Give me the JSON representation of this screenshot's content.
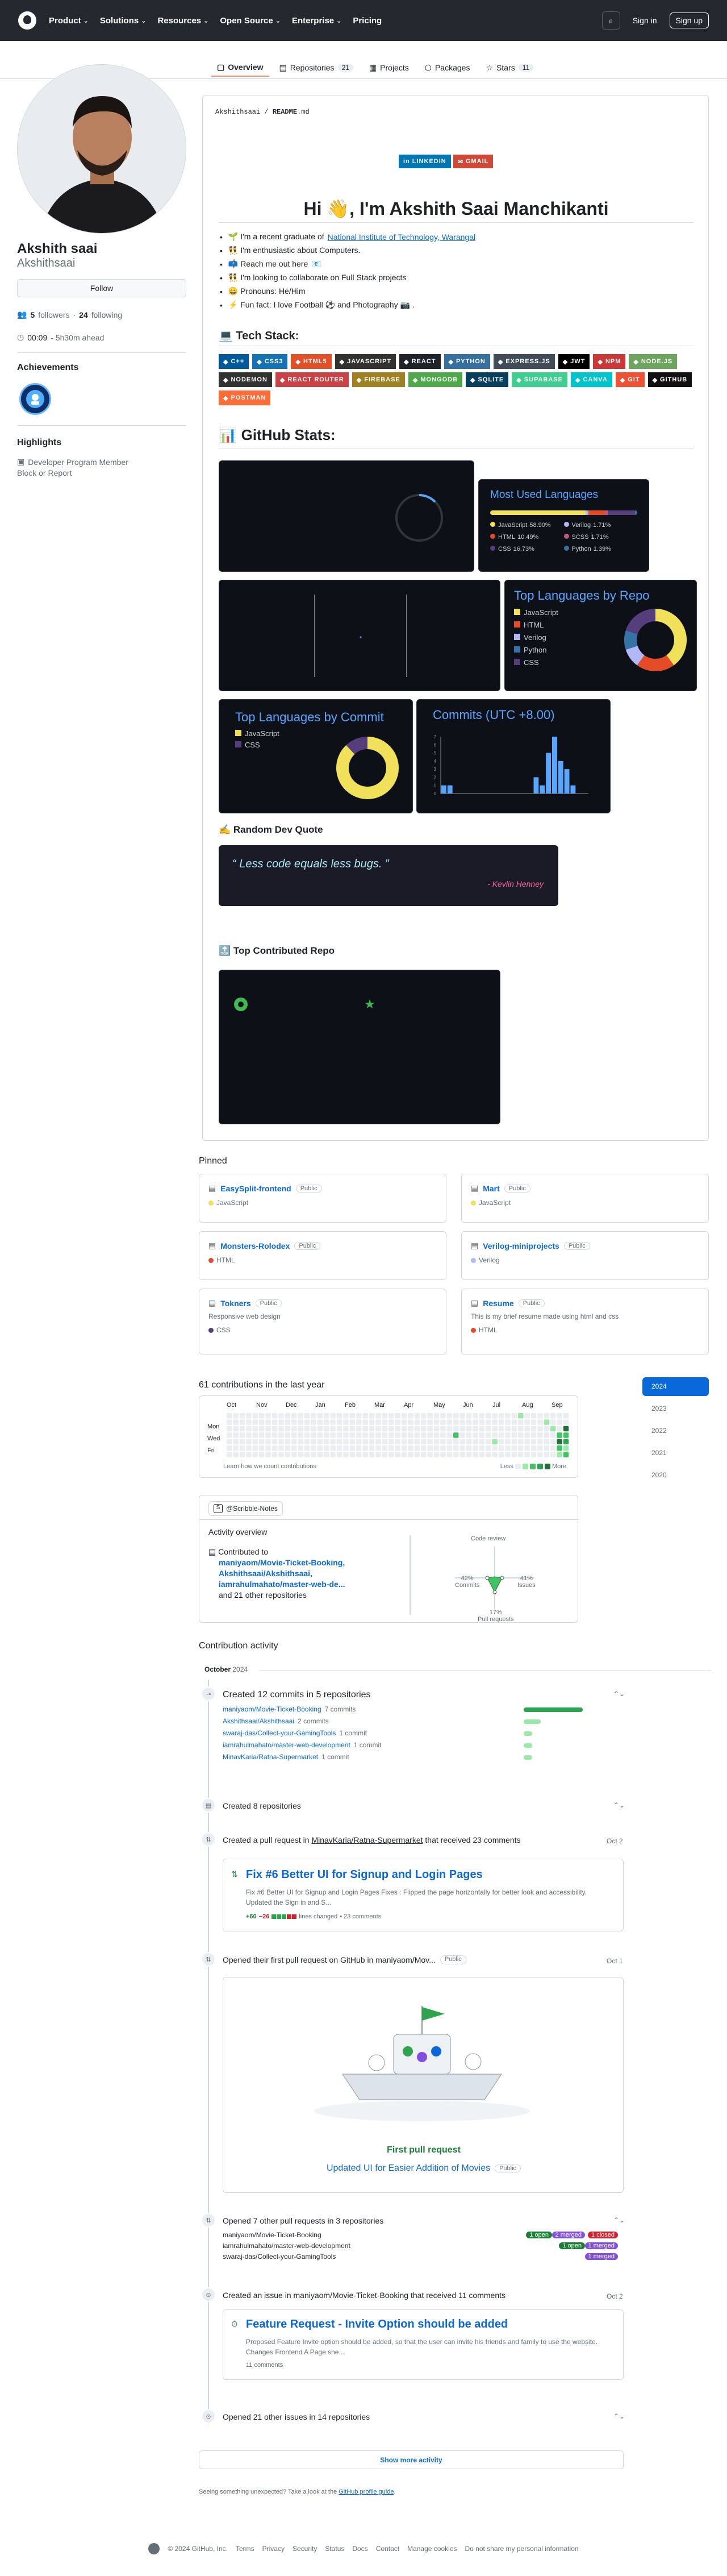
{
  "nav": {
    "items": [
      "Product",
      "Solutions",
      "Resources",
      "Open Source",
      "Enterprise",
      "Pricing"
    ],
    "sign_in": "Sign in",
    "sign_up": "Sign up"
  },
  "tabs": [
    {
      "label": "Overview",
      "count": ""
    },
    {
      "label": "Repositories",
      "count": "21"
    },
    {
      "label": "Projects",
      "count": ""
    },
    {
      "label": "Packages",
      "count": ""
    },
    {
      "label": "Stars",
      "count": "11"
    }
  ],
  "profile": {
    "full_name": "Akshith saai",
    "username": "Akshithsaai",
    "follow_label": "Follow",
    "followers_count": "5",
    "followers_label": "followers",
    "following_count": "24",
    "following_label": "following",
    "local_time": "00:09",
    "tz_offset": "- 5h30m ahead",
    "achievements_h": "Achievements",
    "highlights_h": "Highlights",
    "highlight_item": "Developer Program Member",
    "block_report": "Block or Report"
  },
  "readme": {
    "path_user": "Akshithsaai",
    "path_sep": " / ",
    "path_file": "README",
    "path_ext": ".md",
    "badges": [
      "LINKEDIN",
      "GMAIL"
    ],
    "title": "Hi 👋, I'm Akshith Saai Manchikanti",
    "bullets": [
      {
        "pre": "🌱 I'm a recent graduate of ",
        "link": "National Institute of Technology, Warangal",
        "post": ""
      },
      {
        "pre": "👯 I'm enthusiastic about Computers.",
        "link": "",
        "post": ""
      },
      {
        "pre": "📫 Reach me out here ",
        "link": "📧",
        "post": ""
      },
      {
        "pre": "👯 I'm looking to collaborate on Full Stack projects",
        "link": "",
        "post": ""
      },
      {
        "pre": "😄 Pronouns: He/Him",
        "link": "",
        "post": ""
      },
      {
        "pre": "⚡ Fun fact: I love Football ⚽ and Photography 📷 .",
        "link": "",
        "post": ""
      }
    ],
    "tech_stack_h": "💻 Tech Stack:",
    "tech": [
      {
        "label": "C++",
        "color": "#00599c"
      },
      {
        "label": "CSS3",
        "color": "#1572b6"
      },
      {
        "label": "HTML5",
        "color": "#e34f26"
      },
      {
        "label": "JAVASCRIPT",
        "color": "#323330"
      },
      {
        "label": "REACT",
        "color": "#20232a"
      },
      {
        "label": "PYTHON",
        "color": "#3670a0"
      },
      {
        "label": "EXPRESS.JS",
        "color": "#404d59"
      },
      {
        "label": "JWT",
        "color": "#000000"
      },
      {
        "label": "NPM",
        "color": "#cb3837"
      },
      {
        "label": "NODE.JS",
        "color": "#6da55f"
      },
      {
        "label": "NODEMON",
        "color": "#323330"
      },
      {
        "label": "REACT ROUTER",
        "color": "#ca4245"
      },
      {
        "label": "FIREBASE",
        "color": "#a08021"
      },
      {
        "label": "MONGODB",
        "color": "#4ea94b"
      },
      {
        "label": "SQLITE",
        "color": "#07405e"
      },
      {
        "label": "SUPABASE",
        "color": "#3ecf8e"
      },
      {
        "label": "CANVA",
        "color": "#00c4cc"
      },
      {
        "label": "GIT",
        "color": "#f05033"
      },
      {
        "label": "GITHUB",
        "color": "#121011"
      },
      {
        "label": "POSTMAN",
        "color": "#ff6c37"
      }
    ],
    "stats_h": "📊 GitHub Stats:",
    "most_used_h": "Most Used Languages",
    "most_used": [
      {
        "name": "JavaScript",
        "pct": "58.90%",
        "value": 58.9,
        "color": "#f1e05a"
      },
      {
        "name": "Verilog",
        "pct": "1.71%",
        "value": 1.71,
        "color": "#b2b7f8"
      },
      {
        "name": "HTML",
        "pct": "10.49%",
        "value": 10.49,
        "color": "#e34c26"
      },
      {
        "name": "SCSS",
        "pct": "1.71%",
        "value": 1.71,
        "color": "#c6538c"
      },
      {
        "name": "CSS",
        "pct": "16.73%",
        "value": 16.73,
        "color": "#563d7c"
      },
      {
        "name": "Python",
        "pct": "1.39%",
        "value": 1.39,
        "color": "#3572a5"
      }
    ],
    "top_repo_h": "Top Languages by Repo",
    "top_repo": [
      {
        "name": "JavaScript",
        "color": "#f1e05a",
        "value": 40
      },
      {
        "name": "HTML",
        "color": "#e34c26",
        "value": 20
      },
      {
        "name": "Verilog",
        "color": "#b2b7f8",
        "value": 10
      },
      {
        "name": "Python",
        "color": "#3572a5",
        "value": 10
      },
      {
        "name": "CSS",
        "color": "#563d7c",
        "value": 20
      }
    ],
    "top_commit_h": "Top Languages by Commit",
    "top_commit": [
      {
        "name": "JavaScript",
        "color": "#f1e05a",
        "value": 88
      },
      {
        "name": "CSS",
        "color": "#563d7c",
        "value": 12
      }
    ],
    "commits_h": "Commits (UTC +8.00)",
    "commits_y_ticks": [
      "7",
      "6",
      "5",
      "4",
      "3",
      "2",
      "1",
      "0"
    ],
    "commits_bars": [
      1,
      1,
      0,
      0,
      0,
      0,
      0,
      0,
      0,
      0,
      0,
      0,
      0,
      0,
      0,
      2,
      1,
      5,
      7,
      4,
      3,
      1,
      0,
      0
    ],
    "quote_h": "✍️ Random Dev Quote",
    "quote_text": "“ Less code equals less bugs. ”",
    "quote_author": "- Kevlin Henney",
    "top_repo_section_h": "🔝 Top Contributed Repo"
  },
  "pinned": {
    "heading": "Pinned",
    "public": "Public",
    "items": [
      {
        "name": "EasySplit-frontend",
        "desc": "",
        "lang": "JavaScript",
        "color": "#f1e05a"
      },
      {
        "name": "Mart",
        "desc": "",
        "lang": "JavaScript",
        "color": "#f1e05a"
      },
      {
        "name": "Monsters-Rolodex",
        "desc": "",
        "lang": "HTML",
        "color": "#e34c26"
      },
      {
        "name": "Verilog-miniprojects",
        "desc": "",
        "lang": "Verilog",
        "color": "#b2b7f8"
      },
      {
        "name": "Tokners",
        "desc": "Responsive web design",
        "lang": "CSS",
        "color": "#563d7c"
      },
      {
        "name": "Resume",
        "desc": "This is my brief resume made using html and css",
        "lang": "HTML",
        "color": "#e34c26"
      }
    ]
  },
  "contributions": {
    "heading": "61 contributions in the last year",
    "months": [
      "Oct",
      "Nov",
      "Dec",
      "Jan",
      "Feb",
      "Mar",
      "Apr",
      "May",
      "Jun",
      "Jul",
      "Aug",
      "Sep"
    ],
    "days": [
      "Mon",
      "Wed",
      "Fri"
    ],
    "learn": "Learn how we count contributions",
    "less": "Less",
    "more": "More",
    "years": [
      "2024",
      "2023",
      "2022",
      "2021",
      "2020"
    ],
    "org": "@Scribble-Notes",
    "activity_overview": "Activity overview",
    "contributed_to": "Contributed to",
    "repos": "maniyaom/Movie-Ticket-Booking, Akshithsaai/Akshithsaai, iamrahulmahato/master-web-de...",
    "and_more": "and 21 other repositories",
    "code_review": "Code review",
    "commits_pct": "42%",
    "commits_label": "Commits",
    "issues_pct": "41%",
    "issues_label": "Issues",
    "pr_pct": "17%",
    "pr_label": "Pull requests"
  },
  "activity": {
    "heading": "Contribution activity",
    "month": "October",
    "year": "2024",
    "commits_title": "Created 12 commits in 5 repositories",
    "commit_repos": [
      {
        "name": "maniyaom/Movie-Ticket-Booking",
        "count": "7 commits",
        "value": 7
      },
      {
        "name": "Akshithsaai/Akshithsaai",
        "count": "2 commits",
        "value": 2
      },
      {
        "name": "swaraj-das/Collect-your-GamingTools",
        "count": "1 commit",
        "value": 1
      },
      {
        "name": "iamrahulmahato/master-web-development",
        "count": "1 commit",
        "value": 1
      },
      {
        "name": "MinavKaria/Ratna-Supermarket",
        "count": "1 commit",
        "value": 1
      }
    ],
    "repos_created": "Created 8 repositories",
    "pr_title_pre": "Created a pull request in ",
    "pr_title_repo": "MinavKaria/Ratna-Supermarket",
    "pr_title_post": " that received 23 comments",
    "pr_date": "Oct 2",
    "pr_card_title": "Fix #6 Better UI for Signup and Login Pages",
    "pr_card_body": "Fix #6 Better UI for Signup and Login Pages Fixes : Flipped the page horizontally for better look and accessibility. Updated the Sign in and S...",
    "pr_additions": "+60",
    "pr_deletions": "−26",
    "pr_lines": "lines changed",
    "pr_comments": "• 23 comments",
    "first_pr_title": "Opened their first pull request on GitHub in maniyaom/Mov...",
    "first_pr_public": "Public",
    "first_pr_date": "Oct 1",
    "first_pr_label": "First pull request",
    "first_pr_link": "Updated UI for Easier Addition of Movies",
    "other_prs_title": "Opened 7 other pull requests in 3 repositories",
    "other_prs": [
      {
        "repo": "maniyaom/Movie-Ticket-Booking",
        "pills": [
          "1 open",
          "2 merged",
          "1 closed"
        ]
      },
      {
        "repo": "iamrahulmahato/master-web-development",
        "pills": [
          "1 open",
          "1 merged"
        ]
      },
      {
        "repo": "swaraj-das/Collect-your-GamingTools",
        "pills": [
          "1 merged"
        ]
      }
    ],
    "issue_title": "Created an issue in maniyaom/Movie-Ticket-Booking that received 11 comments",
    "issue_date": "Oct 2",
    "issue_card_title": "Feature Request - Invite Option should be added",
    "issue_card_body": "Proposed Feature Invite option should be added, so that the user can invite his friends and family to use the website. Changes Frontend A Page she...",
    "issue_comments": "11 comments",
    "other_issues": "Opened 21 other issues in 14 repositories",
    "show_more": "Show more activity",
    "unexpected_pre": "Seeing something unexpected? Take a look at the ",
    "unexpected_link": "GitHub profile guide",
    "unexpected_post": "."
  },
  "footer": [
    "© 2024 GitHub, Inc.",
    "Terms",
    "Privacy",
    "Security",
    "Status",
    "Docs",
    "Contact",
    "Manage cookies",
    "Do not share my personal information"
  ]
}
